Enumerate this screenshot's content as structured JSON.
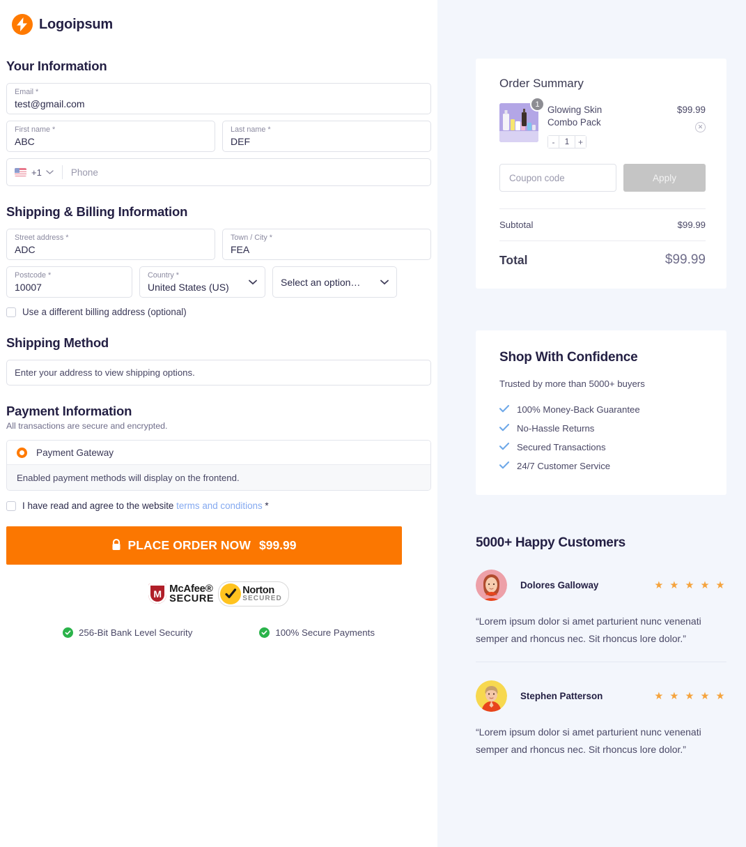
{
  "brand": {
    "name": "Logoipsum",
    "icon": "bolt-icon",
    "accent": "#ff7a00"
  },
  "your_information": {
    "heading": "Your Information",
    "email": {
      "label": "Email *",
      "value": "test@gmail.com"
    },
    "first_name": {
      "label": "First name *",
      "value": "ABC"
    },
    "last_name": {
      "label": "Last name *",
      "value": "DEF"
    },
    "phone": {
      "dial_code": "+1",
      "flag": "us-flag-icon",
      "placeholder": "Phone",
      "value": ""
    }
  },
  "shipping_billing": {
    "heading": "Shipping & Billing Information",
    "street": {
      "label": "Street address *",
      "value": "ADC"
    },
    "city": {
      "label": "Town / City *",
      "value": "FEA"
    },
    "postcode": {
      "label": "Postcode *",
      "value": "10007"
    },
    "country": {
      "label": "Country *",
      "value": "United States (US)"
    },
    "state": {
      "value": "Select an option…"
    },
    "different_billing": {
      "label": "Use a different billing address (optional)",
      "checked": false
    }
  },
  "shipping_method": {
    "heading": "Shipping Method",
    "message": "Enter your address to view shipping options."
  },
  "payment": {
    "heading": "Payment Information",
    "subtitle": "All transactions are secure and encrypted.",
    "gateway_label": "Payment Gateway",
    "gateway_selected": true,
    "gateway_note": "Enabled payment methods will display on the frontend.",
    "terms_prefix": "I have read and agree to the website",
    "terms_link": "terms and conditions",
    "terms_star": "*",
    "terms_checked": false,
    "order_button_label": "PLACE ORDER NOW",
    "order_button_amount": "$99.99",
    "order_button_color": "#fb7701",
    "lock_icon": "lock-icon"
  },
  "trust": {
    "mcafee": {
      "line1": "McAfee®",
      "line2": "SECURE",
      "mark": "M"
    },
    "norton": {
      "line1": "Norton",
      "line2": "SECURED",
      "mark": "check-icon"
    },
    "assurances": [
      {
        "icon": "green-check-icon",
        "label": "256-Bit Bank Level Security"
      },
      {
        "icon": "green-check-icon",
        "label": "100% Secure Payments"
      }
    ]
  },
  "order_summary": {
    "title": "Order Summary",
    "item": {
      "name": "Glowing Skin Combo Pack",
      "price": "$99.99",
      "quantity": "1",
      "badge": "1",
      "thumb": "skincare-products-image",
      "decrement": "-",
      "increment": "+",
      "remove_icon": "remove-item-icon"
    },
    "coupon": {
      "placeholder": "Coupon code",
      "value": "",
      "apply_label": "Apply"
    },
    "subtotal": {
      "label": "Subtotal",
      "value": "$99.99"
    },
    "total": {
      "label": "Total",
      "value": "$99.99"
    }
  },
  "confidence": {
    "title": "Shop With Confidence",
    "subtitle": "Trusted by more than 5000+ buyers",
    "items": [
      "100% Money-Back Guarantee",
      "No-Hassle Returns",
      "Secured Transactions",
      "24/7 Customer Service"
    ]
  },
  "testimonials": {
    "title": "5000+ Happy Customers",
    "entries": [
      {
        "name": "Dolores Galloway",
        "stars": "★ ★ ★ ★ ★",
        "text": "“Lorem ipsum dolor si amet parturient nunc venenati semper and rhoncus nec. Sit rhoncus lore dolor.”",
        "avatar": "woman-avatar"
      },
      {
        "name": "Stephen Patterson",
        "stars": "★ ★ ★ ★ ★",
        "text": "“Lorem ipsum dolor si amet parturient nunc venenati semper and rhoncus nec. Sit rhoncus lore dolor.”",
        "avatar": "man-avatar"
      }
    ]
  }
}
